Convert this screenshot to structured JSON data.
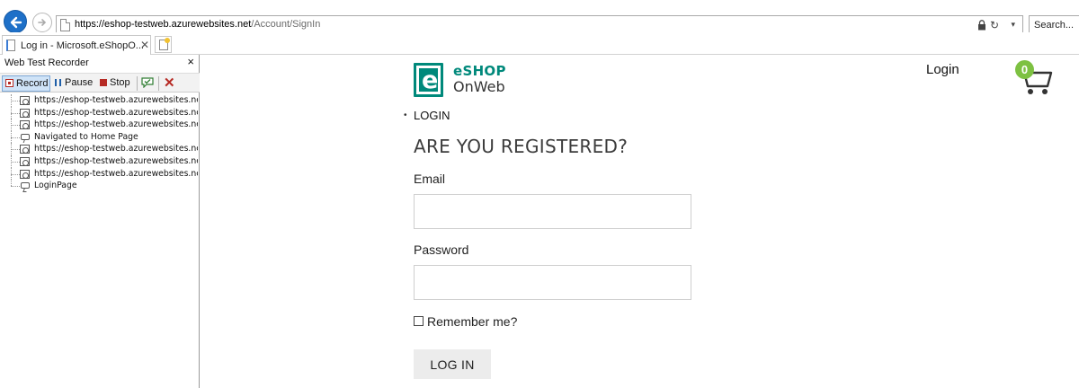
{
  "browser": {
    "url_host": "https://eshop-testweb.azurewebsites.net",
    "url_path": "/Account/SignIn",
    "search_placeholder": "Search...",
    "tab_title": "Log in - Microsoft.eShopO..."
  },
  "recorder": {
    "title": "Web Test Recorder",
    "close": "×",
    "toolbar": {
      "record": "Record",
      "pause": "Pause",
      "stop": "Stop",
      "delete": "✕"
    },
    "items": [
      {
        "type": "request",
        "text": "https://eshop-testweb.azurewebsites.net/"
      },
      {
        "type": "request",
        "text": "https://eshop-testweb.azurewebsites.net/for"
      },
      {
        "type": "request",
        "text": "https://eshop-testweb.azurewebsites.net/for"
      },
      {
        "type": "comment",
        "text": "Navigated to Home Page"
      },
      {
        "type": "request",
        "text": "https://eshop-testweb.azurewebsites.net/Ac"
      },
      {
        "type": "request",
        "text": "https://eshop-testweb.azurewebsites.net/for"
      },
      {
        "type": "request",
        "text": "https://eshop-testweb.azurewebsites.net/for"
      },
      {
        "type": "comment",
        "text": "LoginPage"
      }
    ]
  },
  "page": {
    "logo_line1": "eSHOP",
    "logo_line2": "OnWeb",
    "logo_mark": "e",
    "header_login": "Login",
    "cart_count": "0",
    "breadcrumb": "LOGIN",
    "heading": "ARE YOU REGISTERED?",
    "email_label": "Email",
    "email_value": "",
    "password_label": "Password",
    "password_value": "",
    "remember_label": "Remember me?",
    "login_button": "LOG IN"
  },
  "colors": {
    "brand": "#00897b",
    "cart_badge": "#7dc142",
    "back_button": "#1e70c8"
  }
}
